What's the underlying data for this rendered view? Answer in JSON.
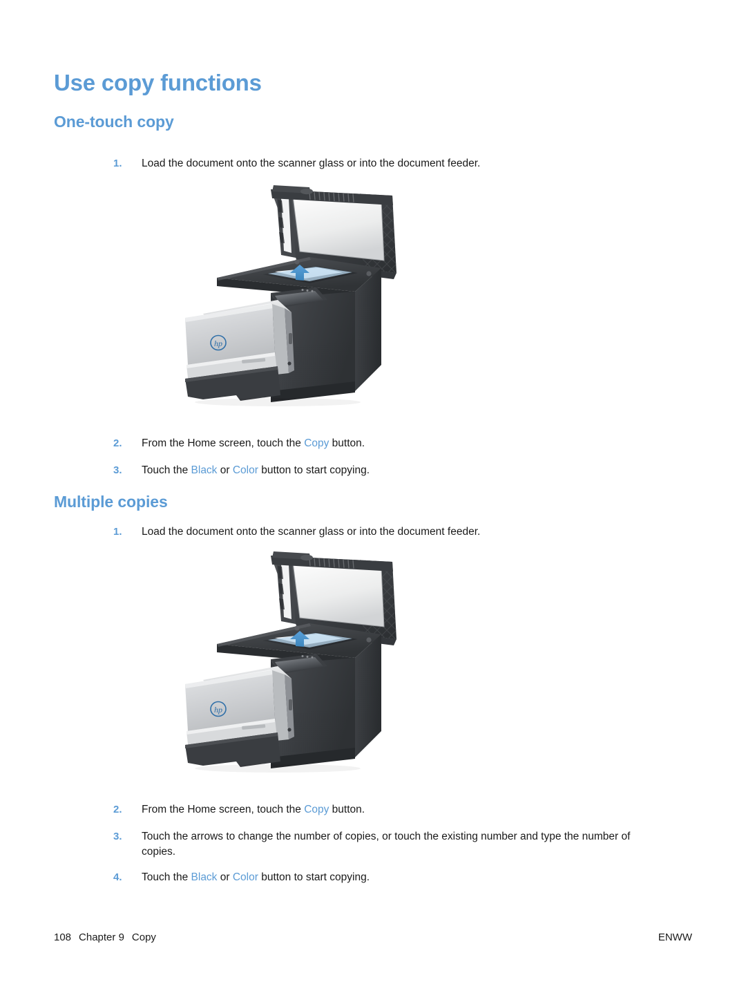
{
  "document": {
    "title": "Use copy functions",
    "sections": [
      {
        "heading": "One-touch copy",
        "steps": [
          {
            "num": "1.",
            "text": "Load the document onto the scanner glass or into the document feeder."
          },
          {
            "num": "2.",
            "pre": "From the Home screen, touch the ",
            "ref1": "Copy",
            "mid": " button.",
            "post": ""
          },
          {
            "num": "3.",
            "pre": "Touch the ",
            "ref1": "Black",
            "mid": " or ",
            "ref2": "Color",
            "post": " button to start copying."
          }
        ]
      },
      {
        "heading": "Multiple copies",
        "steps": [
          {
            "num": "1.",
            "text": "Load the document onto the scanner glass or into the document feeder."
          },
          {
            "num": "2.",
            "pre": "From the Home screen, touch the ",
            "ref1": "Copy",
            "mid": " button.",
            "post": ""
          },
          {
            "num": "3.",
            "text": "Touch the arrows to change the number of copies, or touch the existing number and type the number of copies."
          },
          {
            "num": "4.",
            "pre": "Touch the ",
            "ref1": "Black",
            "mid": " or ",
            "ref2": "Color",
            "post": " button to start copying."
          }
        ]
      }
    ]
  },
  "figures": {
    "alt": "HP multifunction printer with scanner lid open and a document placed face down on the scanner glass, blue arrow indicating placement direction",
    "logo": "hp-logo"
  },
  "footer": {
    "page_number": "108",
    "chapter": "Chapter 9",
    "chapter_title": "Copy",
    "language_code": "ENWW"
  },
  "colors": {
    "heading_blue": "#5b9bd5",
    "ui_reference_blue": "#5b9bd5",
    "body_text": "#1a1a1a",
    "page_background": "#ffffff",
    "printer_body_dark": "#3d4043",
    "printer_body_light": "#c9cbcd",
    "arrow_blue": "#4a90c8"
  }
}
